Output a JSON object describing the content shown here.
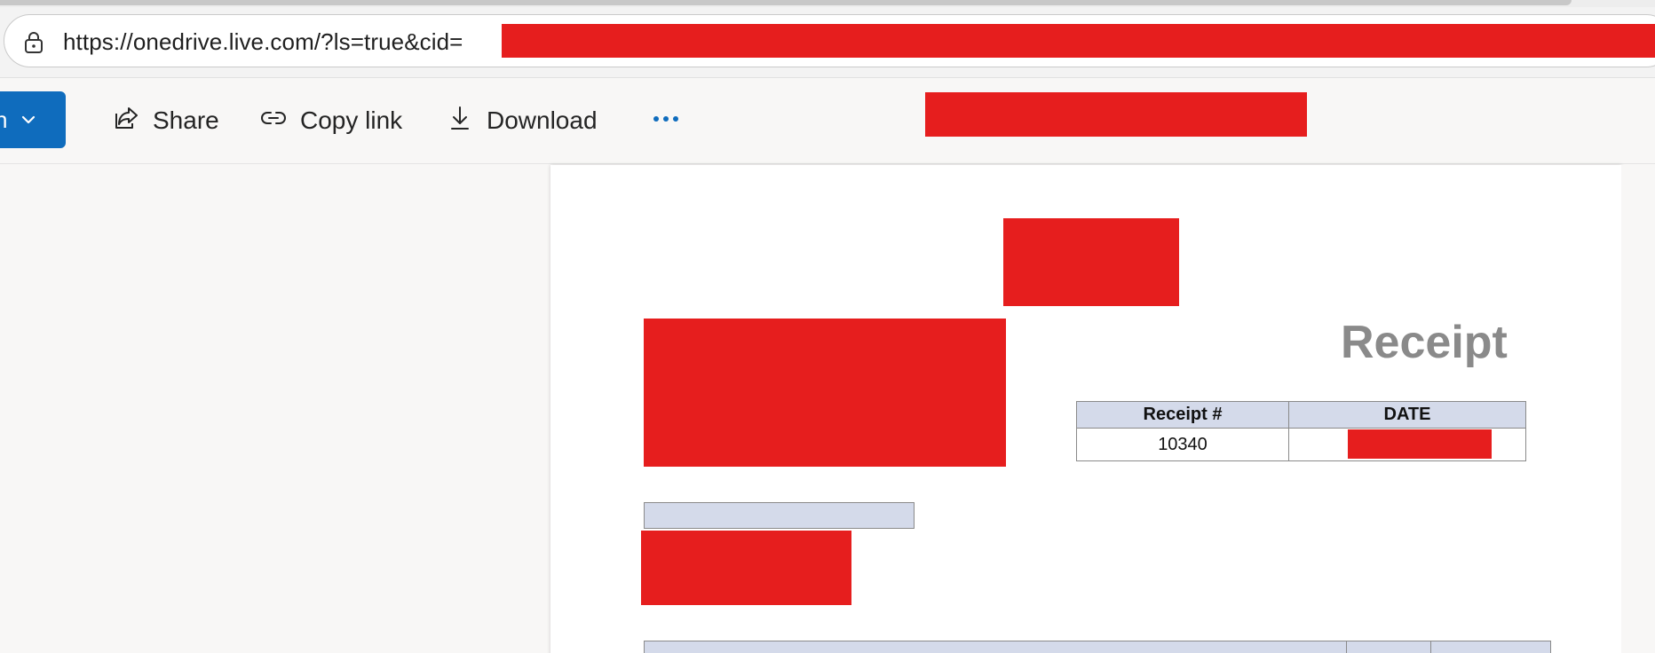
{
  "browser": {
    "url_visible": "https://onedrive.live.com/?ls=true&cid="
  },
  "toolbar": {
    "open_label": "n",
    "share_label": "Share",
    "copy_link_label": "Copy link",
    "download_label": "Download"
  },
  "document": {
    "title": "Receipt",
    "meta_table": {
      "headers": [
        "Receipt #",
        "DATE"
      ],
      "receipt_number": "10340"
    }
  },
  "colors": {
    "accent": "#0f6cbd",
    "header_fill": "#d4daea",
    "redaction": "#e61e1e",
    "title_gray": "#8a8a8a"
  }
}
